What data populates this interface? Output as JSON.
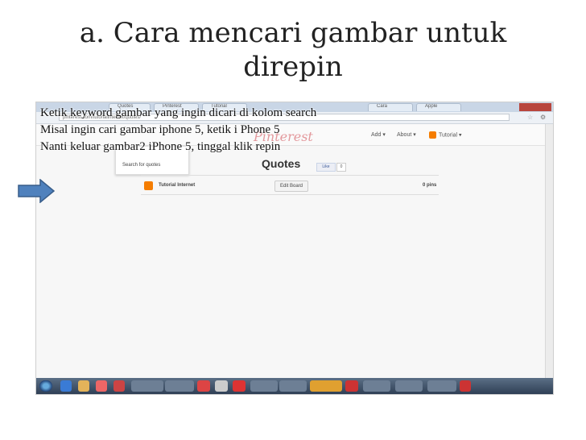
{
  "slide": {
    "title_line1": "a. Cara mencari gambar untuk",
    "title_line2": "direpin",
    "instructions": [
      "Ketik  keyword gambar yang ingin dicari di kolom search",
      "Misal ingin cari gambar iphone 5, ketik i Phone 5",
      "Nanti keluar gambar2 iPhone 5, tinggal klik repin"
    ]
  },
  "browser": {
    "tabs": [
      "Quotes",
      "Pinterest",
      "Tutorial",
      "Cara",
      "Apple"
    ],
    "url": "pinterest.com/tutorialinternet/quotes/"
  },
  "pinterest": {
    "logo": "Pinterest",
    "nav_add": "Add ▾",
    "nav_about": "About ▾",
    "nav_user": "Tutorial ▾",
    "search_menu_item": "Search for quotes",
    "board_title": "Quotes",
    "like_label": "Like",
    "like_count": "0",
    "board_row": {
      "name": "Tutorial Internet",
      "edit_label": "Edit Board",
      "pins": "0 pins"
    }
  },
  "colors": {
    "arrow": "#4f81bd",
    "pinterest_red": "#c8232c",
    "blogger_orange": "#f57d00"
  },
  "icons": [
    "arrow-right-icon",
    "star-icon",
    "wrench-icon",
    "blogger-icon",
    "windows-start-icon"
  ]
}
